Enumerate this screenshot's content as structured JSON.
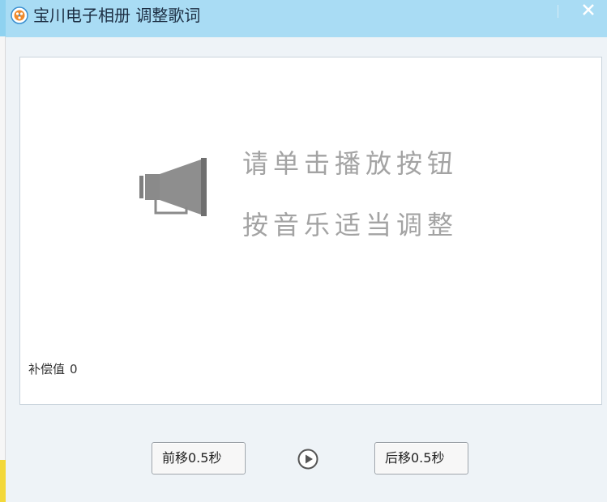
{
  "window": {
    "title": "宝川电子相册 调整歌词",
    "icon": "app-logo-icon",
    "close_icon": "close-icon"
  },
  "panel": {
    "line1": "请单击播放按钮",
    "line2": "按音乐适当调整",
    "speaker_icon": "speaker-icon",
    "offset_label": "补偿值",
    "offset_value": "0"
  },
  "controls": {
    "back_label": "前移0.5秒",
    "play_icon": "play-icon",
    "forward_label": "后移0.5秒"
  },
  "colors": {
    "titlebar": "#a9dcf4",
    "body": "#eef3f7",
    "hint_text": "#a3a3a3"
  }
}
